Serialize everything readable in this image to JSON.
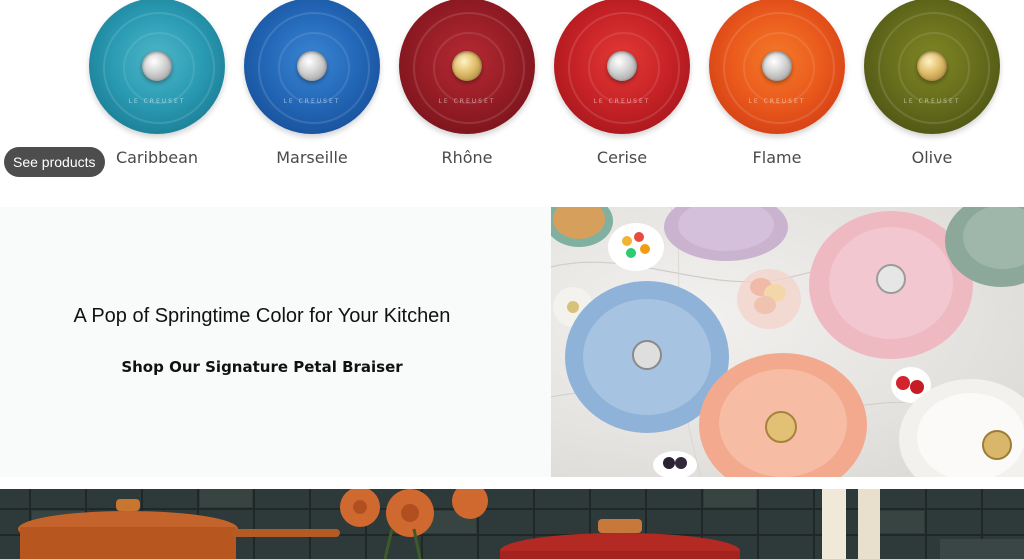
{
  "swatches": [
    {
      "label": "Caribbean",
      "color": "#1f8fa8",
      "knob": "silver"
    },
    {
      "label": "Marseille",
      "color": "#1d5fae",
      "knob": "silver"
    },
    {
      "label": "Rhône",
      "color": "#8d1a22",
      "knob": "gold"
    },
    {
      "label": "Cerise",
      "color": "#c01d22",
      "knob": "silver"
    },
    {
      "label": "Flame",
      "color": "#e8471a",
      "knob": "silver"
    },
    {
      "label": "Olive",
      "color": "#5c6317",
      "knob": "gold"
    }
  ],
  "lid_brand": "LE CREUSET",
  "see_products_label": "See products",
  "promo": {
    "heading": "A Pop of Springtime Color for Your Kitchen",
    "link_label": "Shop Our Signature Petal Braiser"
  },
  "colors": {
    "swatch_label": "#4a4a4a",
    "pill_background": "#4d4d4d",
    "promo_panel": "#f9fbfb",
    "banner_tiles": "#2e3a39"
  }
}
